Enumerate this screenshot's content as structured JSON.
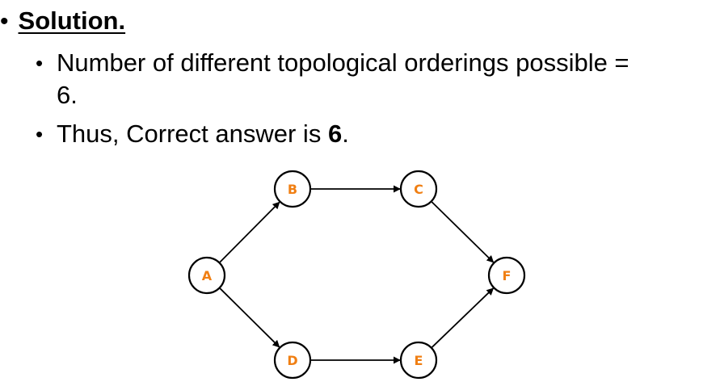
{
  "heading": {
    "bullet": "•",
    "title": "Solution."
  },
  "items": [
    {
      "bullet": "•",
      "line1": "Number of different topological orderings possible =",
      "line2": "6."
    },
    {
      "bullet": "•",
      "prefix": "Thus, Correct answer is ",
      "answer": "6",
      "suffix": "."
    }
  ],
  "graph": {
    "label_color": "#f07f13",
    "nodes": [
      {
        "id": "A",
        "label": "A"
      },
      {
        "id": "B",
        "label": "B"
      },
      {
        "id": "C",
        "label": "C"
      },
      {
        "id": "D",
        "label": "D"
      },
      {
        "id": "E",
        "label": "E"
      },
      {
        "id": "F",
        "label": "F"
      }
    ],
    "edges": [
      {
        "from": "A",
        "to": "B"
      },
      {
        "from": "B",
        "to": "C"
      },
      {
        "from": "C",
        "to": "F"
      },
      {
        "from": "A",
        "to": "D"
      },
      {
        "from": "D",
        "to": "E"
      },
      {
        "from": "E",
        "to": "F"
      }
    ]
  }
}
